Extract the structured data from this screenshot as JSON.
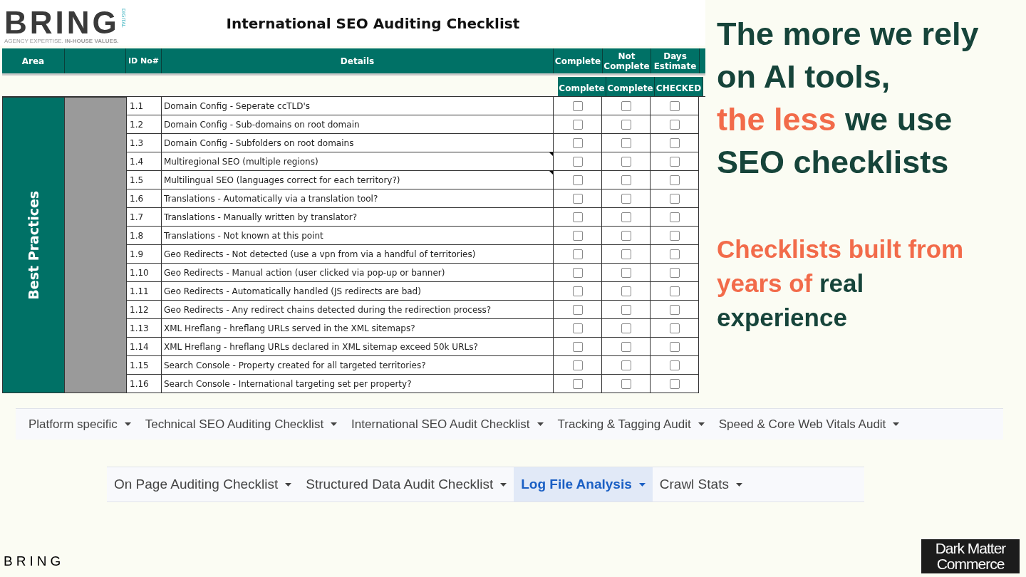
{
  "sheet": {
    "logo": {
      "name": "BRING",
      "badge": "DIGITAL",
      "tagline": "AGENCY EXPERTISE. **IN-HOUSE VALUES.**"
    },
    "title": "International SEO Auditing Checklist",
    "columns": [
      "Area",
      "",
      "ID No#",
      "Details",
      "Complete",
      "Not Complete",
      "Days Estimate"
    ],
    "subheader": [
      "Complete",
      "Complete",
      "CHECKED"
    ],
    "area": "Best Practices",
    "rows": [
      {
        "id": "1.1",
        "details": "Domain Config - Seperate ccTLD's",
        "note": false,
        "complete": false,
        "not_complete": false,
        "checked": false
      },
      {
        "id": "1.2",
        "details": "Domain Config - Sub-domains on root domain",
        "note": false,
        "complete": false,
        "not_complete": false,
        "checked": false
      },
      {
        "id": "1.3",
        "details": "Domain Config - Subfolders on root domains",
        "note": false,
        "complete": false,
        "not_complete": false,
        "checked": false
      },
      {
        "id": "1.4",
        "details": "Multiregional SEO (multiple regions)",
        "note": true,
        "complete": false,
        "not_complete": false,
        "checked": false
      },
      {
        "id": "1.5",
        "details": "Multilingual SEO (languages correct for each territory?)",
        "note": true,
        "complete": false,
        "not_complete": false,
        "checked": false
      },
      {
        "id": "1.6",
        "details": "Translations - Automatically via a translation tool?",
        "note": false,
        "complete": false,
        "not_complete": false,
        "checked": false
      },
      {
        "id": "1.7",
        "details": "Translations - Manually written by translator?",
        "note": false,
        "complete": false,
        "not_complete": false,
        "checked": false
      },
      {
        "id": "1.8",
        "details": "Translations - Not known at this point",
        "note": false,
        "complete": false,
        "not_complete": false,
        "checked": false
      },
      {
        "id": "1.9",
        "details": "Geo Redirects - Not detected (use a vpn from via a handful of territories)",
        "note": false,
        "complete": false,
        "not_complete": false,
        "checked": false
      },
      {
        "id": "1.10",
        "details": "Geo Redirects - Manual action (user clicked via pop-up or banner)",
        "note": false,
        "complete": false,
        "not_complete": false,
        "checked": false
      },
      {
        "id": "1.11",
        "details": "Geo Redirects - Automatically handled (JS redirects are bad)",
        "note": false,
        "complete": false,
        "not_complete": false,
        "checked": false
      },
      {
        "id": "1.12",
        "details": "Geo Redirects - Any redirect chains detected during the redirection process?",
        "note": false,
        "complete": false,
        "not_complete": false,
        "checked": false
      },
      {
        "id": "1.13",
        "details": "XML Hreflang - hreflang URLs served in the XML sitemaps?",
        "note": false,
        "complete": false,
        "not_complete": false,
        "checked": false
      },
      {
        "id": "1.14",
        "details": "XML Hreflang - hreflang URLs declared in XML sitemap exceed 50k URLs?",
        "note": false,
        "complete": false,
        "not_complete": false,
        "checked": false
      },
      {
        "id": "1.15",
        "details": "Search Console - Property created for all targeted territories?",
        "note": false,
        "complete": false,
        "not_complete": false,
        "checked": false
      },
      {
        "id": "1.16",
        "details": "Search Console - International targeting set per property?",
        "note": false,
        "complete": false,
        "not_complete": false,
        "checked": false
      }
    ]
  },
  "headline": [
    [
      {
        "text": "The more we rely",
        "kind": "dark"
      }
    ],
    [
      {
        "text": "on AI tools,",
        "kind": "dark"
      }
    ],
    [
      {
        "text": "the less",
        "kind": "accent"
      },
      {
        "text": "we use",
        "kind": "dark"
      }
    ],
    [
      {
        "text": "SEO checklists",
        "kind": "dark"
      }
    ]
  ],
  "subline": [
    [
      {
        "text": "Checklists built from",
        "kind": "accent"
      }
    ],
    [
      {
        "text": "years of",
        "kind": "accent"
      },
      {
        "text": "real",
        "kind": "dark"
      }
    ],
    [
      {
        "text": "experience",
        "kind": "dark"
      }
    ]
  ],
  "tab_bars": [
    [
      {
        "label": "Platform specific",
        "selected": false
      },
      {
        "label": "Technical SEO Auditing Checklist",
        "selected": false
      },
      {
        "label": "International SEO Audit Checklist",
        "selected": false
      },
      {
        "label": "Tracking & Tagging Audit",
        "selected": false
      },
      {
        "label": "Speed & Core Web Vitals Audit",
        "selected": false
      }
    ],
    [
      {
        "label": "On Page Auditing Checklist",
        "selected": false
      },
      {
        "label": "Structured Data Audit Checklist",
        "selected": false
      },
      {
        "label": "Log File Analysis",
        "selected": true
      },
      {
        "label": "Crawl Stats",
        "selected": false
      }
    ]
  ],
  "footer": {
    "brand": "BRING",
    "partner": "Dark Matter Commerce"
  }
}
